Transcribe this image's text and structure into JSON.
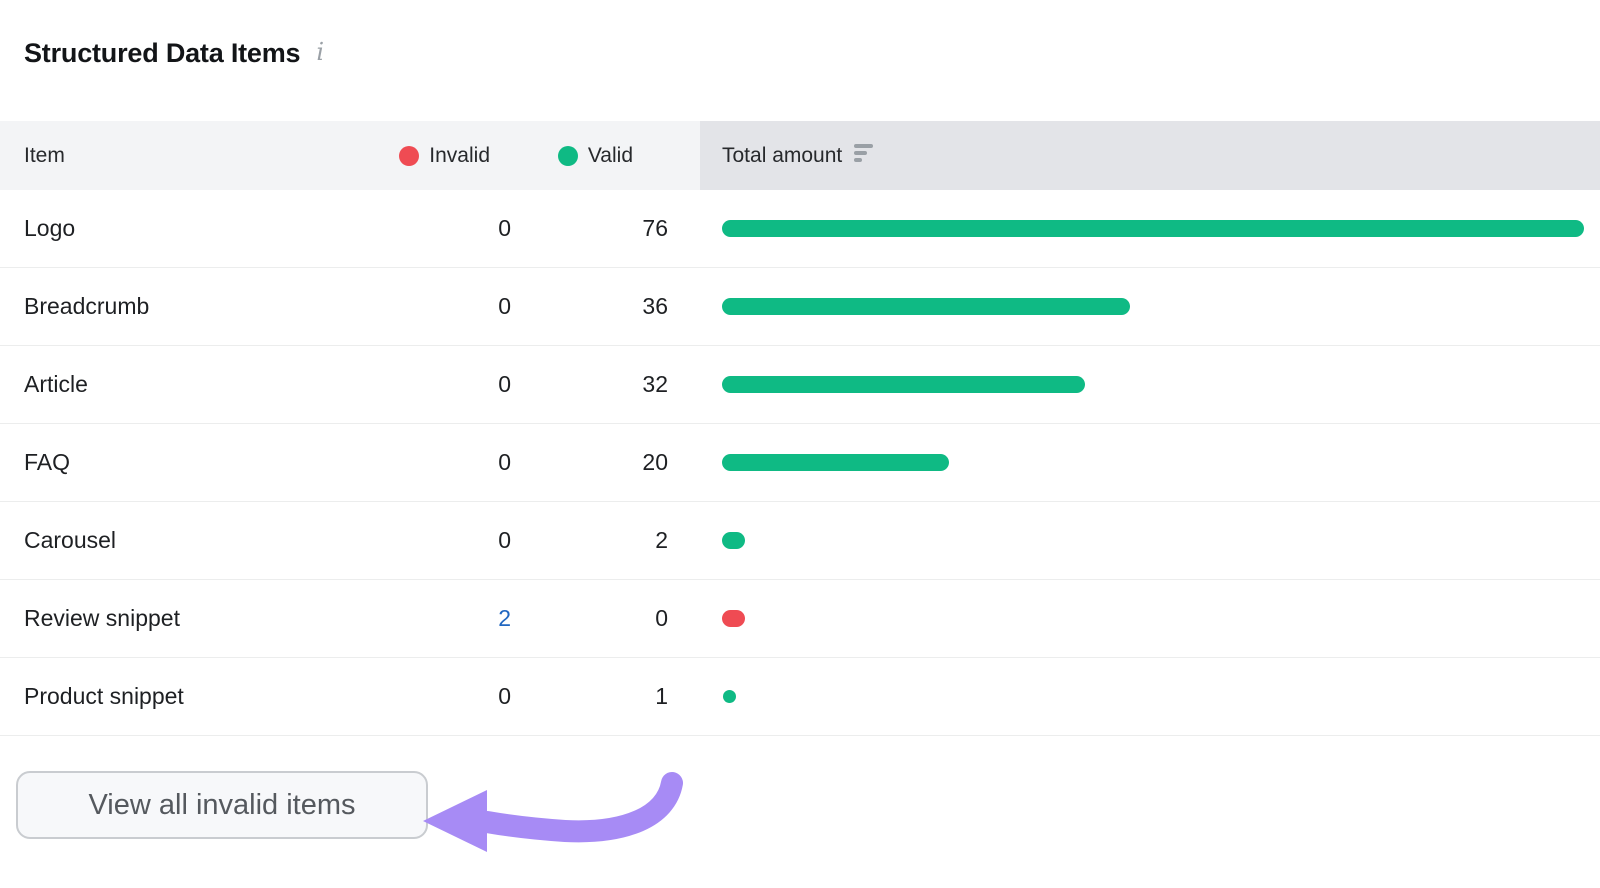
{
  "page": {
    "title": "Structured Data Items"
  },
  "icons": {
    "info": "i"
  },
  "table": {
    "item_header": "Item",
    "legend": {
      "invalid": "Invalid",
      "valid": "Valid"
    },
    "total_header": "Total amount",
    "bar_max": 76,
    "rows": [
      {
        "item": "Logo",
        "invalid": "0",
        "valid": "76",
        "bar_value": 76,
        "bar_status": "valid"
      },
      {
        "item": "Breadcrumb",
        "invalid": "0",
        "valid": "36",
        "bar_value": 36,
        "bar_status": "valid"
      },
      {
        "item": "Article",
        "invalid": "0",
        "valid": "32",
        "bar_value": 32,
        "bar_status": "valid"
      },
      {
        "item": "FAQ",
        "invalid": "0",
        "valid": "20",
        "bar_value": 20,
        "bar_status": "valid"
      },
      {
        "item": "Carousel",
        "invalid": "0",
        "valid": "2",
        "bar_value": 2,
        "bar_status": "valid"
      },
      {
        "item": "Review snippet",
        "invalid": "2",
        "invalid_link": true,
        "valid": "0",
        "bar_value": 2,
        "bar_status": "invalid"
      },
      {
        "item": "Product snippet",
        "invalid": "0",
        "valid": "1",
        "bar_value": 1,
        "bar_status": "valid"
      }
    ]
  },
  "colors": {
    "valid": "#0fba84",
    "invalid": "#ef4b53",
    "link": "#2167c1",
    "arrow": "#a78bf5"
  },
  "footer": {
    "view_all_button": "View all invalid items"
  }
}
